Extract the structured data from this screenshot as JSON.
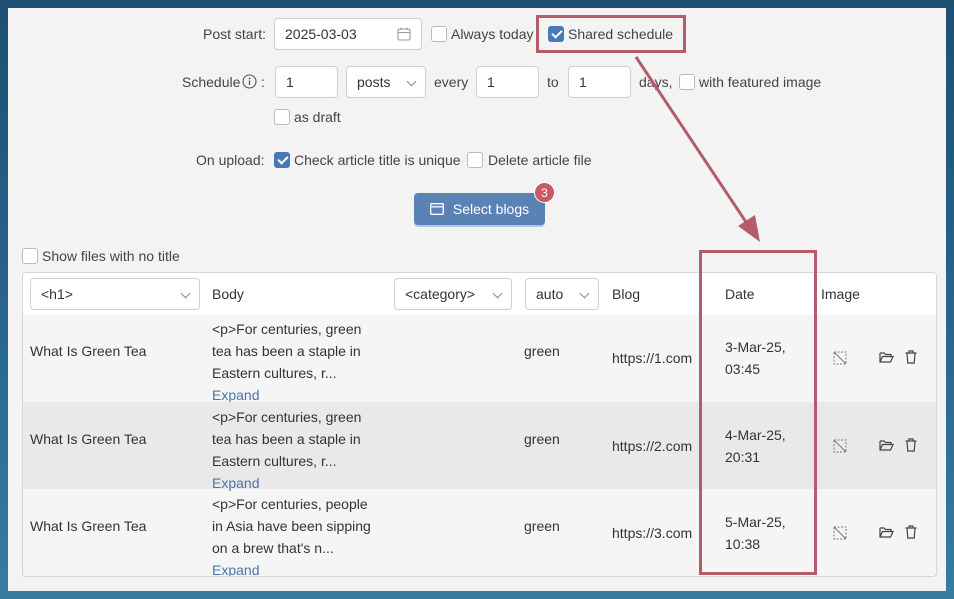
{
  "form": {
    "post_start_label": "Post start",
    "post_start_value": "2025-03-03",
    "always_today_label": "Always today",
    "shared_schedule_label": "Shared schedule",
    "schedule_label": "Schedule",
    "schedule_count": "1",
    "schedule_unit": "posts",
    "every_label": "every",
    "every_value": "1",
    "to_label": "to",
    "to_value": "1",
    "days_label": "days,",
    "featured_image_label": "with featured image",
    "as_draft_label": "as draft",
    "on_upload_label": "On upload",
    "check_title_label": "Check article title is unique",
    "delete_file_label": "Delete article file",
    "select_blogs_label": "Select blogs",
    "select_blogs_count": "3",
    "show_no_title_label": "Show files with no title"
  },
  "table": {
    "headers": {
      "title_select": "<h1>",
      "body": "Body",
      "category_select": "<category>",
      "auto_select": "auto",
      "blog": "Blog",
      "date": "Date",
      "image": "Image"
    },
    "rows": [
      {
        "title": "What Is Green Tea",
        "body_l1": "<p>For centuries, green",
        "body_l2": "tea has been a staple in",
        "body_l3": "Eastern cultures, r...",
        "expand": "Expand",
        "category": "green",
        "blog": "https://1.com",
        "date_l1": "3-Mar-25,",
        "date_l2": "03:45"
      },
      {
        "title": "What Is Green Tea",
        "body_l1": "<p>For centuries, green",
        "body_l2": "tea has been a staple in",
        "body_l3": "Eastern cultures, r...",
        "expand": "Expand",
        "category": "green",
        "blog": "https://2.com",
        "date_l1": "4-Mar-25,",
        "date_l2": "20:31"
      },
      {
        "title": "What Is Green Tea",
        "body_l1": "<p>For centuries, people",
        "body_l2": "in Asia have been sipping",
        "body_l3": "on a brew that's n...",
        "expand": "Expand",
        "category": "green",
        "blog": "https://3.com",
        "date_l1": "5-Mar-25,",
        "date_l2": "10:38"
      }
    ]
  },
  "colors": {
    "accent": "#4a78b4",
    "button": "#5b82b5",
    "badge": "#c75a64",
    "highlight": "#b45d69"
  }
}
